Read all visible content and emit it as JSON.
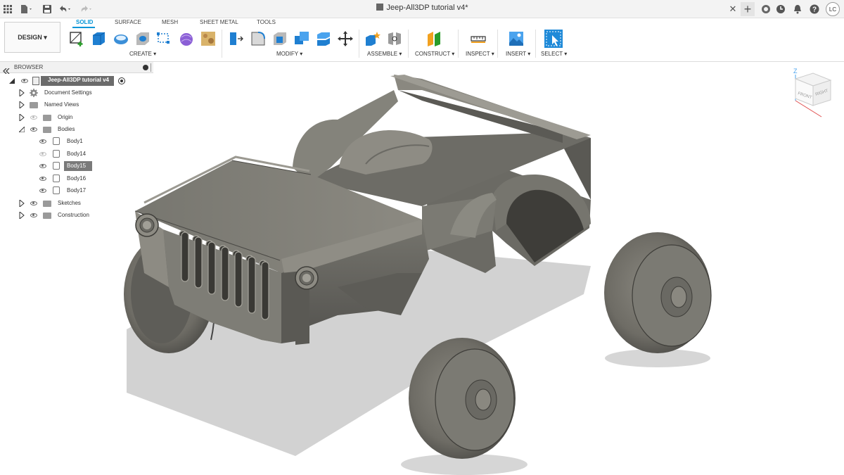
{
  "titlebar": {
    "doc_title": "Jeep-All3DP tutorial v4*",
    "avatar_initials": "LC",
    "icons": [
      "grid-icon",
      "file-icon",
      "save-icon",
      "undo-icon",
      "redo-icon",
      "close-icon",
      "plus-icon",
      "extensions-icon",
      "history-icon",
      "notification-icon",
      "help-icon"
    ]
  },
  "toolbar": {
    "workspace": "DESIGN ▾",
    "tabs": [
      "SOLID",
      "SURFACE",
      "MESH",
      "SHEET METAL",
      "TOOLS"
    ],
    "active_tab": "SOLID",
    "groups": [
      "CREATE ▾",
      "MODIFY ▾",
      "ASSEMBLE ▾",
      "CONSTRUCT ▾",
      "INSPECT ▾",
      "INSERT ▾",
      "SELECT ▾"
    ],
    "accent": "#0696d7"
  },
  "browser": {
    "title": "BROWSER",
    "root": "Jeep-All3DP tutorial v4",
    "items": [
      {
        "label": "Document Settings",
        "icon": "gear-icon"
      },
      {
        "label": "Named Views",
        "icon": "folder-icon"
      },
      {
        "label": "Origin",
        "icon": "folder-icon"
      },
      {
        "label": "Bodies",
        "icon": "folder-icon"
      },
      {
        "label": "Body1",
        "icon": "body-icon"
      },
      {
        "label": "Body14",
        "icon": "body-icon"
      },
      {
        "label": "Body15",
        "icon": "body-icon"
      },
      {
        "label": "Body16",
        "icon": "body-icon"
      },
      {
        "label": "Body17",
        "icon": "body-icon"
      },
      {
        "label": "Sketches",
        "icon": "folder-icon"
      },
      {
        "label": "Construction",
        "icon": "folder-icon"
      }
    ]
  },
  "viewcube": {
    "axis_label": "Z",
    "faces": [
      "FRONT",
      "RIGHT"
    ]
  }
}
